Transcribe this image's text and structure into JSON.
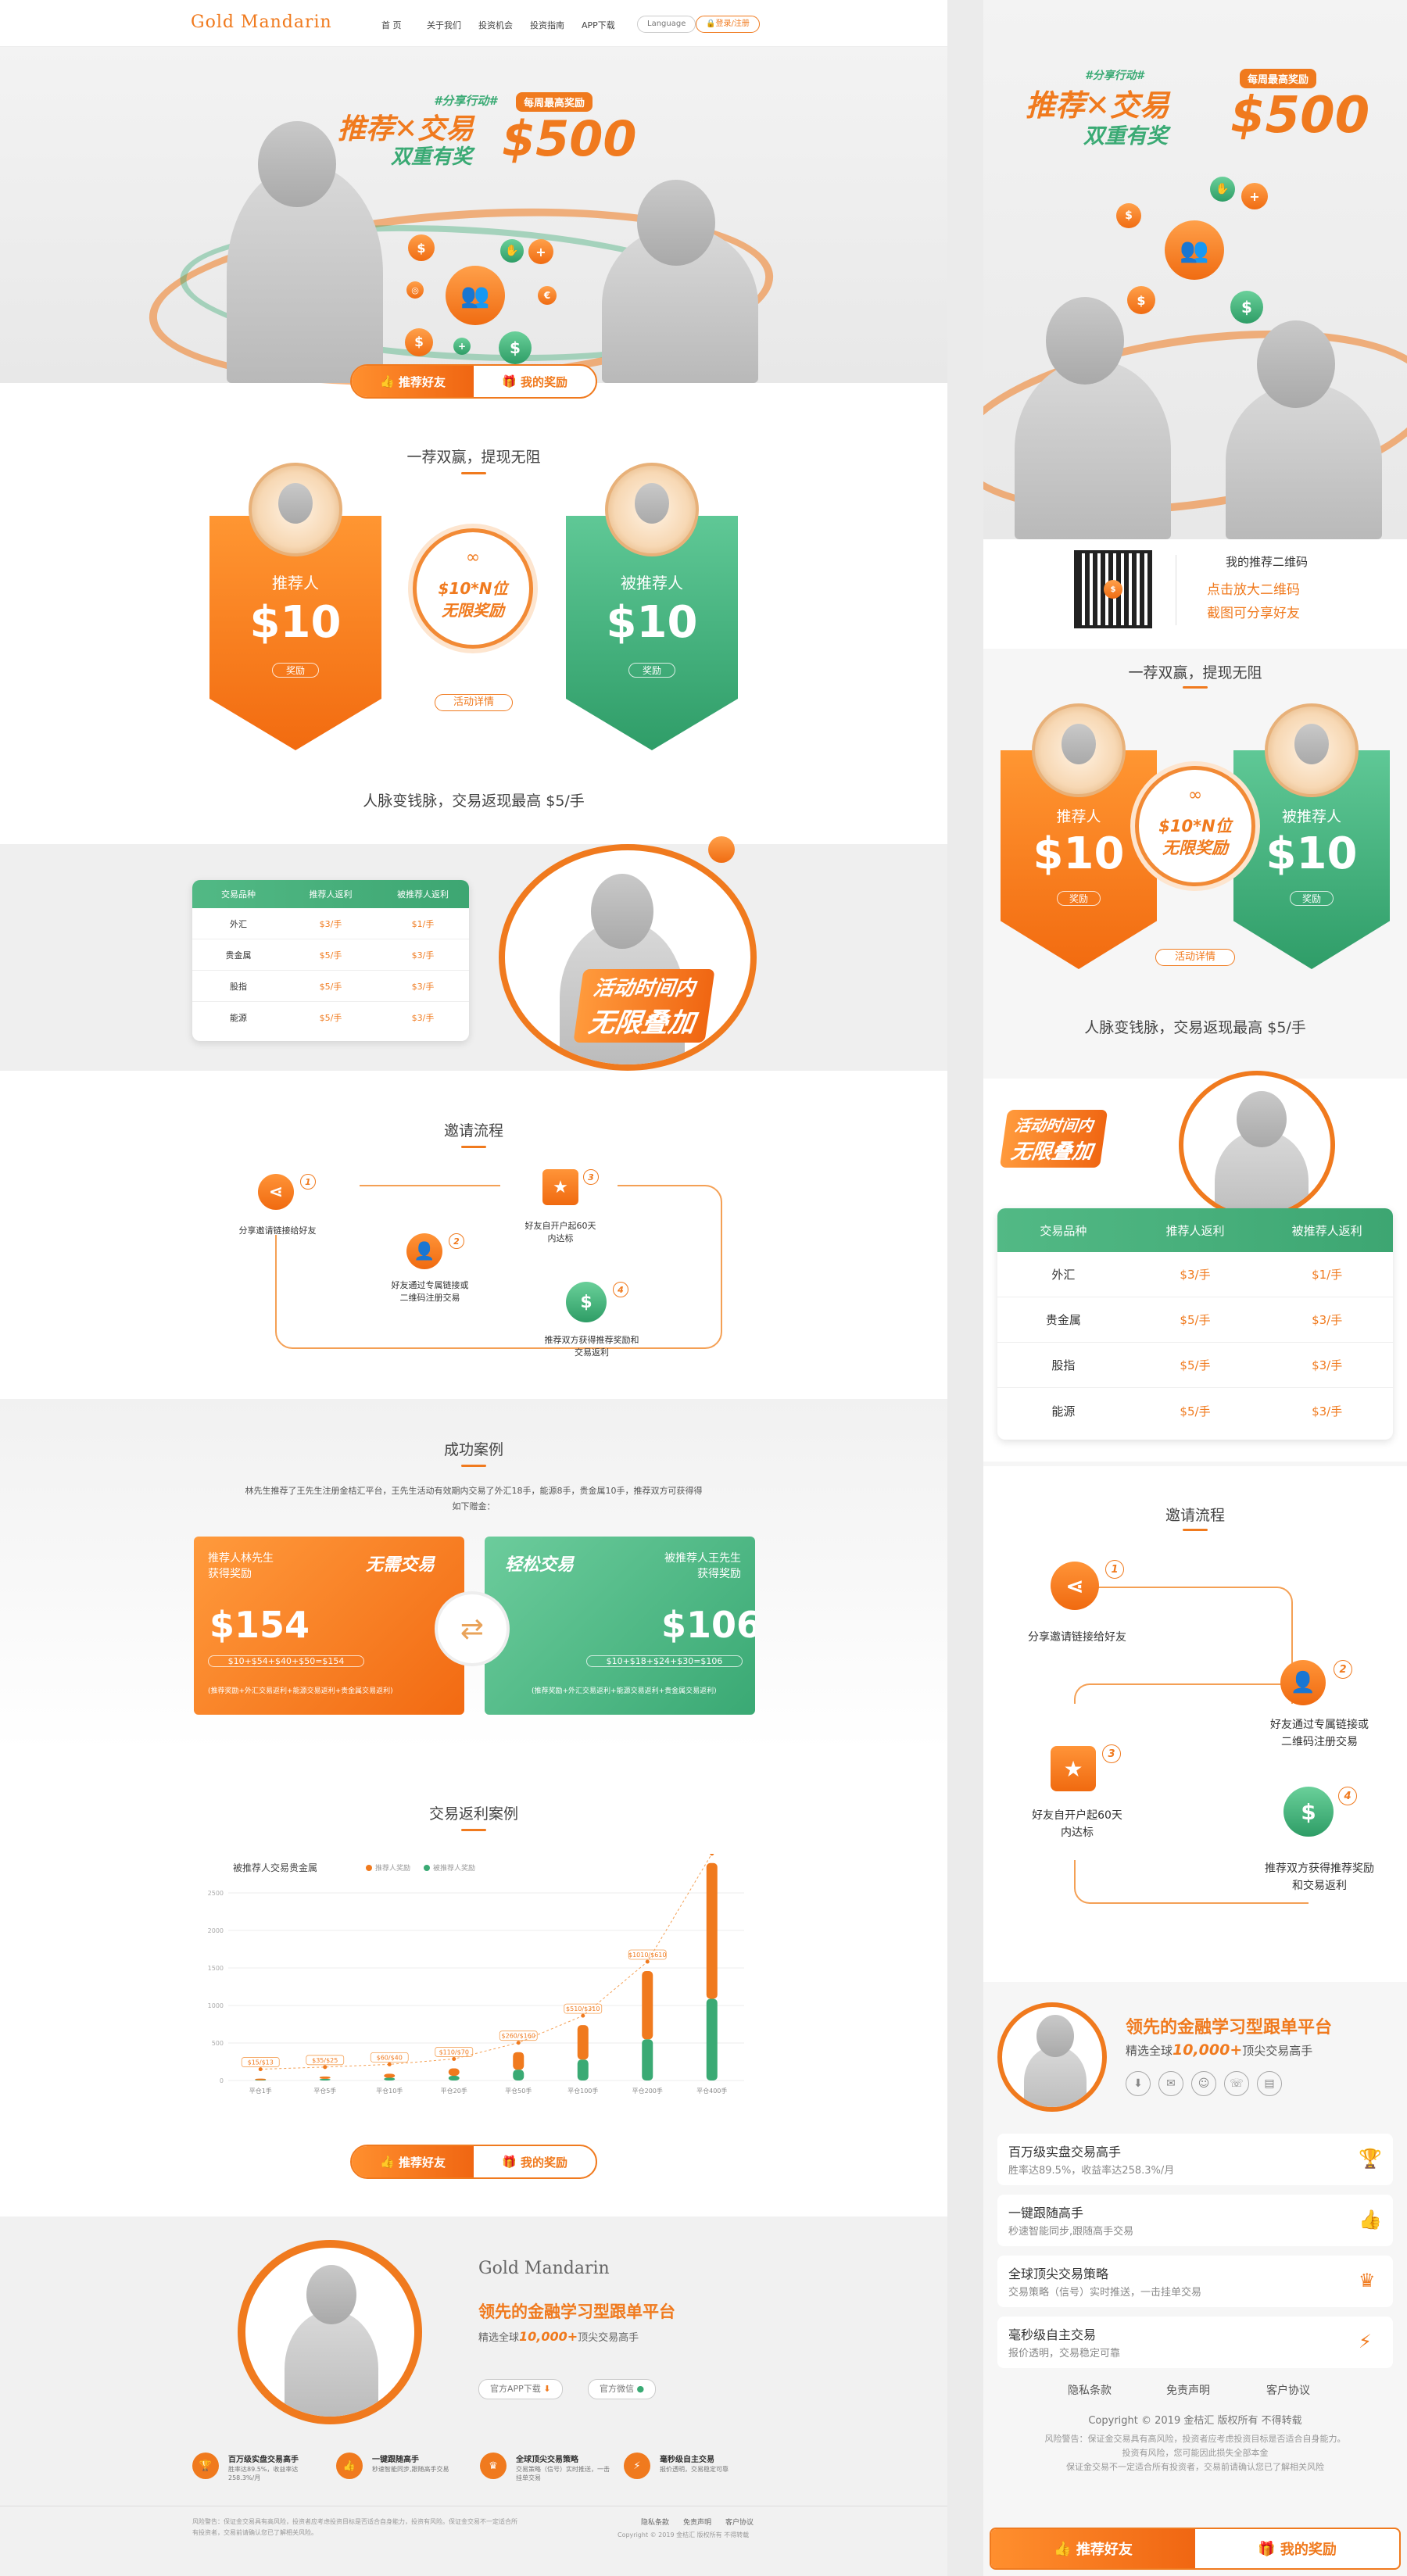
{
  "desktop": {
    "nav": {
      "logo": "Gold Mandarin",
      "links": [
        "首 页",
        "关于我们",
        "投资机会",
        "投资指南",
        "APP下载"
      ],
      "language": "Language",
      "login": "登录/注册"
    },
    "hero": {
      "tag": "#分享行动#",
      "line1": "推荐✕交易",
      "line2": "双重有奖",
      "badge": "每周最高奖励",
      "amount": "$500"
    },
    "tabs": {
      "refer": "推荐好友",
      "rewards": "我的奖励"
    },
    "sec1": {
      "title": "一荐双赢，提现无阻",
      "left_label": "推荐人",
      "left_amount": "$10",
      "left_btn": "奖励",
      "mid_line1": "$10*N位",
      "mid_line2": "无限奖励",
      "right_label": "被推荐人",
      "right_amount": "$10",
      "right_btn": "奖励",
      "details": "活动详情"
    },
    "sec2": {
      "title": "人脉变钱脉，交易返现最高 $5/手",
      "promo1": "活动时间内",
      "promo2": "无限叠加",
      "headers": [
        "交易品种",
        "推荐人返利",
        "被推荐人返利"
      ],
      "rows": [
        [
          "外汇",
          "$3/手",
          "$1/手"
        ],
        [
          "贵金属",
          "$5/手",
          "$3/手"
        ],
        [
          "股指",
          "$5/手",
          "$3/手"
        ],
        [
          "能源",
          "$5/手",
          "$3/手"
        ]
      ]
    },
    "sec3": {
      "title": "邀请流程",
      "steps": [
        "分享邀请链接给好友",
        "好友通过专属链接或\n二维码注册交易",
        "好友自开户起60天\n内达标",
        "推荐双方获得推荐奖励和\n交易返利"
      ],
      "nums": [
        "1",
        "2",
        "3",
        "4"
      ],
      "badge60": "60"
    },
    "sec4": {
      "title": "成功案例",
      "desc": "林先生推荐了王先生注册金桔汇平台，王先生活动有效期内交易了外汇18手，能源8手，贵金属10手，推荐双方可获得得如下赠金：",
      "left": {
        "who": "推荐人林先生\n获得奖励",
        "slogan": "无需交易",
        "amount": "$154",
        "formula": "$10+$54+$40+$50=$154",
        "note": "(推荐奖励+外汇交易返利+能源交易返利+贵金属交易返利)"
      },
      "right": {
        "who": "被推荐人王先生\n获得奖励",
        "slogan": "轻松交易",
        "amount": "$106",
        "formula": "$10+$18+$24+$30=$106",
        "note": "(推荐奖励+外汇交易返利+能源交易返利+贵金属交易返利)"
      }
    },
    "sec5": {
      "title": "交易返利案例"
    },
    "footer": {
      "brand": "Gold Mandarin",
      "slogan": "领先的金融学习型跟单平台",
      "sub_pre": "精选全球",
      "sub_num": "10,000+",
      "sub_post": "顶尖交易高手",
      "app_btn": "官方APP下载",
      "wechat_btn": "官方微信",
      "features": [
        [
          "百万级实盘交易高手",
          "胜率达89.5%，收益率达258.3%/月"
        ],
        [
          "一键跟随高手",
          "秒速智能同步,跟随高手交易"
        ],
        [
          "全球顶尖交易策略",
          "交易策略（信号）实时推送，一击挂单交易"
        ],
        [
          "毫秒级自主交易",
          "报价透明，交易稳定可靠"
        ]
      ],
      "risk": "风险警告：保证金交易具有高风险，投资者应考虑投资目标是否适合自身能力，投资有风险。保证金交易不一定适合所有投资者，交易前请确认您已了解相关风险。",
      "links": [
        "隐私条款",
        "免责声明",
        "客户协议"
      ],
      "copyright": "Copyright © 2019 金桔汇 版权所有 不得转载"
    }
  },
  "chart_data": {
    "type": "bar",
    "title": "被推荐人交易贵金属",
    "legend": [
      "推荐人奖励",
      "被推荐人奖励"
    ],
    "categories": [
      "平仓1手",
      "平仓5手",
      "平仓10手",
      "平仓20手",
      "平仓50手",
      "平仓100手",
      "平仓200手",
      "平仓400手"
    ],
    "series": [
      {
        "name": "推荐人奖励",
        "values": [
          15,
          35,
          60,
          110,
          260,
          510,
          1010,
          2010
        ]
      },
      {
        "name": "被推荐人奖励",
        "values": [
          13,
          25,
          40,
          70,
          160,
          310,
          610,
          1210
        ]
      }
    ],
    "labels": [
      "$15/$13",
      "$35/$25",
      "$60/$40",
      "$110/$70",
      "$260/$160",
      "$510/$310",
      "$1010/$610",
      "$2010/$1210"
    ],
    "yticks": [
      "0",
      "500",
      "1000",
      "1500",
      "2000",
      "2500"
    ],
    "ylim": [
      0,
      2500
    ]
  },
  "mobile": {
    "hero": {
      "tag": "#分享行动#",
      "line1": "推荐✕交易",
      "line2": "双重有奖",
      "badge": "每周最高奖励",
      "amount": "$500"
    },
    "qr": {
      "title": "我的推荐二维码",
      "line1": "点击放大二维码",
      "line2": "截图可分享好友"
    },
    "sec1": {
      "title": "一荐双赢，提现无阻",
      "left_label": "推荐人",
      "left_amount": "$10",
      "left_btn": "奖励",
      "mid_line1": "$10*N位",
      "mid_line2": "无限奖励",
      "right_label": "被推荐人",
      "right_amount": "$10",
      "right_btn": "奖励",
      "details": "活动详情"
    },
    "sec2": {
      "title": "人脉变钱脉，交易返现最高 $5/手",
      "promo1": "活动时间内",
      "promo2": "无限叠加",
      "headers": [
        "交易品种",
        "推荐人返利",
        "被推荐人返利"
      ],
      "rows": [
        [
          "外汇",
          "$3/手",
          "$1/手"
        ],
        [
          "贵金属",
          "$5/手",
          "$3/手"
        ],
        [
          "股指",
          "$5/手",
          "$3/手"
        ],
        [
          "能源",
          "$5/手",
          "$3/手"
        ]
      ]
    },
    "sec3": {
      "title": "邀请流程",
      "steps": [
        "分享邀请链接给好友",
        "好友通过专属链接或\n二维码注册交易",
        "好友自开户起60天\n内达标",
        "推荐双方获得推荐奖励\n和交易返利"
      ],
      "nums": [
        "1",
        "2",
        "3",
        "4"
      ],
      "badge60": "60"
    },
    "promo": {
      "slogan": "领先的金融学习型跟单平台",
      "sub_pre": "精选全球",
      "sub_num": "10,000+",
      "sub_post": "顶尖交易高手"
    },
    "features": [
      [
        "百万级实盘交易高手",
        "胜率达89.5%，收益率达258.3%/月"
      ],
      [
        "一键跟随高手",
        "秒速智能同步,跟随高手交易"
      ],
      [
        "全球顶尖交易策略",
        "交易策略（信号）实时推送，一击挂单交易"
      ],
      [
        "毫秒级自主交易",
        "报价透明，交易稳定可靠"
      ]
    ],
    "links": [
      "隐私条款",
      "免责声明",
      "客户协议"
    ],
    "copyright": "Copyright © 2019 金桔汇 版权所有 不得转载",
    "risk": [
      "风险警告：保证金交易具有高风险，投资者应考虑投资目标是否适合自身能力。",
      "投资有风险，您可能因此损失全部本金",
      "保证金交易不一定适合所有投资者，交易前请确认您已了解相关风险"
    ],
    "tabs": {
      "refer": "推荐好友",
      "rewards": "我的奖励"
    }
  }
}
